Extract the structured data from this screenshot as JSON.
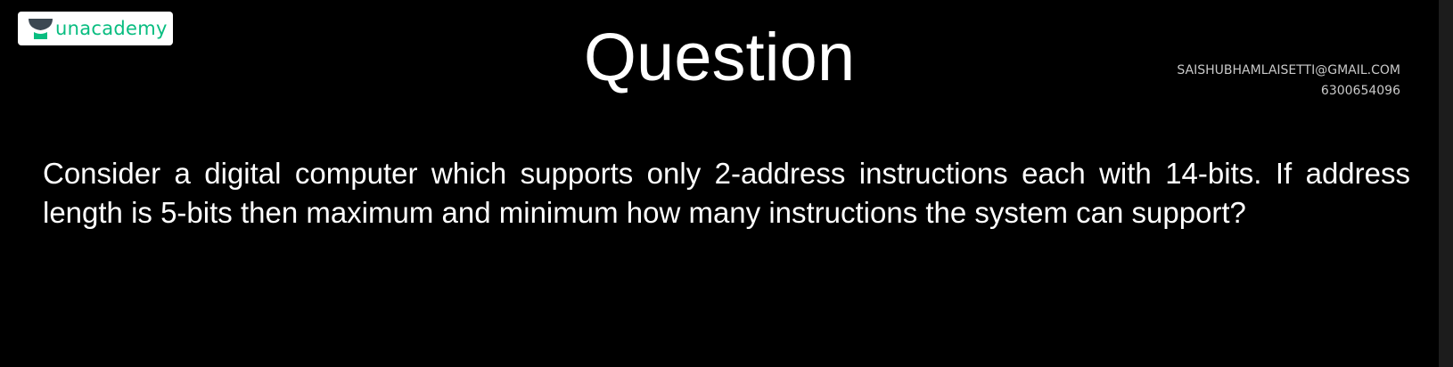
{
  "brand": {
    "name": "unacademy",
    "accent_color": "#08bd80",
    "icon": "unacademy-logo-icon"
  },
  "slide": {
    "title": "Question",
    "question_text": "Consider a digital computer which supports only 2-address instructions each with 14-bits. If address length is 5-bits then maximum and minimum how many instructions the system can support?"
  },
  "watermark": {
    "email": "SAISHUBHAMLAISETTI@GMAIL.COM",
    "phone": "6300654096"
  }
}
